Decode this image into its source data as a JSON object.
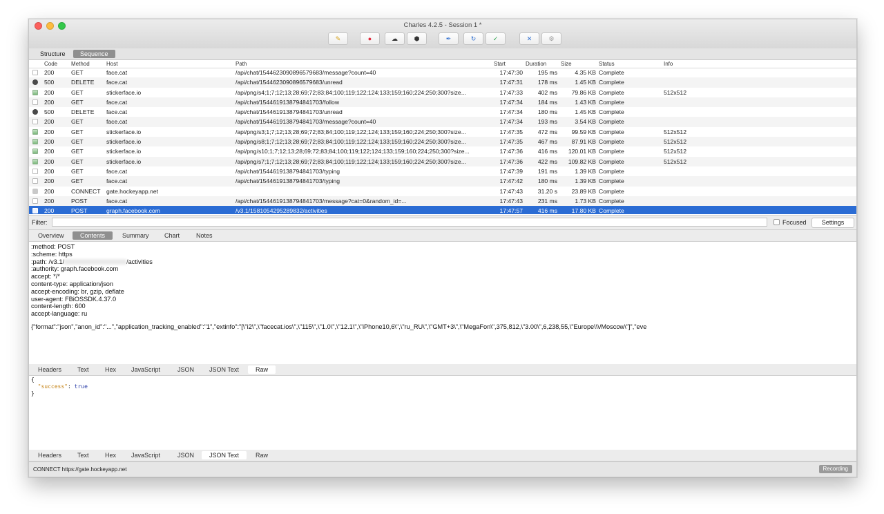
{
  "window": {
    "title": "Charles 4.2.5 - Session 1 *"
  },
  "toolbar": {
    "buttons": [
      {
        "name": "broom-icon",
        "glyph": "✎",
        "color": "#d6a21a"
      },
      {
        "name": "record-icon",
        "glyph": "●",
        "color": "#e0283b"
      },
      {
        "name": "throttle-icon",
        "glyph": "☁",
        "color": "#333333"
      },
      {
        "name": "breakpoint-icon",
        "glyph": "⬢",
        "color": "#333333"
      },
      {
        "name": "pen-icon",
        "glyph": "✒",
        "color": "#2f6fd0"
      },
      {
        "name": "refresh-icon",
        "glyph": "↻",
        "color": "#2f6fd0"
      },
      {
        "name": "check-icon",
        "glyph": "✓",
        "color": "#2aa34b"
      },
      {
        "name": "tools-icon",
        "glyph": "✕",
        "color": "#2f6fd0"
      },
      {
        "name": "settings-icon",
        "glyph": "⚙",
        "color": "#999999"
      }
    ]
  },
  "view_tabs": [
    "Structure",
    "Sequence"
  ],
  "columns": {
    "code": "Code",
    "method": "Method",
    "host": "Host",
    "path": "Path",
    "start": "Start",
    "duration": "Duration",
    "size": "Size",
    "status": "Status",
    "info": "Info"
  },
  "rows": [
    {
      "icon": "doc",
      "code": "200",
      "method": "GET",
      "host": "face.cat",
      "path": "/api/chat/1544623090896579683/message?count=40",
      "start": "17:47:30",
      "duration": "195 ms",
      "size": "4.35 KB",
      "status": "Complete",
      "info": ""
    },
    {
      "icon": "err",
      "code": "500",
      "method": "DELETE",
      "host": "face.cat",
      "path": "/api/chat/1544623090896579683/unread",
      "start": "17:47:31",
      "duration": "178 ms",
      "size": "1.45 KB",
      "status": "Complete",
      "info": ""
    },
    {
      "icon": "img",
      "code": "200",
      "method": "GET",
      "host": "stickerface.io",
      "path": "/api/png/s4;1;7;12;13;28;69;72;83;84;100;119;122;124;133;159;160;224;250;300?size...",
      "start": "17:47:33",
      "duration": "402 ms",
      "size": "79.86 KB",
      "status": "Complete",
      "info": "512x512"
    },
    {
      "icon": "doc",
      "code": "200",
      "method": "GET",
      "host": "face.cat",
      "path": "/api/chat/1544619138794841703/follow",
      "start": "17:47:34",
      "duration": "184 ms",
      "size": "1.43 KB",
      "status": "Complete",
      "info": ""
    },
    {
      "icon": "err",
      "code": "500",
      "method": "DELETE",
      "host": "face.cat",
      "path": "/api/chat/1544619138794841703/unread",
      "start": "17:47:34",
      "duration": "180 ms",
      "size": "1.45 KB",
      "status": "Complete",
      "info": ""
    },
    {
      "icon": "doc",
      "code": "200",
      "method": "GET",
      "host": "face.cat",
      "path": "/api/chat/1544619138794841703/message?count=40",
      "start": "17:47:34",
      "duration": "193 ms",
      "size": "3.54 KB",
      "status": "Complete",
      "info": ""
    },
    {
      "icon": "img",
      "code": "200",
      "method": "GET",
      "host": "stickerface.io",
      "path": "/api/png/s3;1;7;12;13;28;69;72;83;84;100;119;122;124;133;159;160;224;250;300?size...",
      "start": "17:47:35",
      "duration": "472 ms",
      "size": "99.59 KB",
      "status": "Complete",
      "info": "512x512"
    },
    {
      "icon": "img",
      "code": "200",
      "method": "GET",
      "host": "stickerface.io",
      "path": "/api/png/s8;1;7;12;13;28;69;72;83;84;100;119;122;124;133;159;160;224;250;300?size...",
      "start": "17:47:35",
      "duration": "467 ms",
      "size": "87.91 KB",
      "status": "Complete",
      "info": "512x512"
    },
    {
      "icon": "img",
      "code": "200",
      "method": "GET",
      "host": "stickerface.io",
      "path": "/api/png/s10;1;7;12;13;28;69;72;83;84;100;119;122;124;133;159;160;224;250;300?size...",
      "start": "17:47:36",
      "duration": "416 ms",
      "size": "120.01 KB",
      "status": "Complete",
      "info": "512x512"
    },
    {
      "icon": "img",
      "code": "200",
      "method": "GET",
      "host": "stickerface.io",
      "path": "/api/png/s7;1;7;12;13;28;69;72;83;84;100;119;122;124;133;159;160;224;250;300?size...",
      "start": "17:47:36",
      "duration": "422 ms",
      "size": "109.82 KB",
      "status": "Complete",
      "info": "512x512"
    },
    {
      "icon": "doc",
      "code": "200",
      "method": "GET",
      "host": "face.cat",
      "path": "/api/chat/1544619138794841703/typing",
      "start": "17:47:39",
      "duration": "191 ms",
      "size": "1.39 KB",
      "status": "Complete",
      "info": ""
    },
    {
      "icon": "doc",
      "code": "200",
      "method": "GET",
      "host": "face.cat",
      "path": "/api/chat/1544619138794841703/typing",
      "start": "17:47:42",
      "duration": "180 ms",
      "size": "1.39 KB",
      "status": "Complete",
      "info": ""
    },
    {
      "icon": "lock",
      "code": "200",
      "method": "CONNECT",
      "host": "gate.hockeyapp.net",
      "path": "",
      "start": "17:47:43",
      "duration": "31.20 s",
      "size": "23.89 KB",
      "status": "Complete",
      "info": ""
    },
    {
      "icon": "doc",
      "code": "200",
      "method": "POST",
      "host": "face.cat",
      "path": "/api/chat/1544619138794841703/message?cat=0&random_id=...",
      "start": "17:47:43",
      "duration": "231 ms",
      "size": "1.73 KB",
      "status": "Complete",
      "info": ""
    },
    {
      "icon": "doc",
      "code": "200",
      "method": "POST",
      "host": "graph.facebook.com",
      "path": "/v3.1/1581054295289832/activities",
      "start": "17:47:57",
      "duration": "416 ms",
      "size": "17.80 KB",
      "status": "Complete",
      "info": "",
      "selected": true
    }
  ],
  "filter": {
    "label": "Filter:",
    "value": "",
    "focused_label": "Focused",
    "settings_label": "Settings"
  },
  "detail_tabs": [
    "Overview",
    "Contents",
    "Summary",
    "Chart",
    "Notes"
  ],
  "headers": [
    ":method: POST",
    ":scheme: https",
    ":path: /v3.1/",
    ":authority: graph.facebook.com",
    "accept: */*",
    "content-type: application/json",
    "accept-encoding: br, gzip, deflate",
    "user-agent: FBiOSSDK.4.37.0",
    "content-length: 600",
    "accept-language: ru"
  ],
  "path_suffix": "/activities",
  "request_body": "{\"format\":\"json\",\"anon_id\":\"...\",\"application_tracking_enabled\":\"1\",\"extinfo\":\"[\\\"i2\\\",\\\"facecat.ios\\\",\\\"115\\\",\\\"1.0\\\",\\\"12.1\\\",\\\"iPhone10,6\\\",\\\"ru_RU\\\",\\\"GMT+3\\\",\\\"MegaFon\\\",375,812,\\\"3.00\\\",6,238,55,\\\"Europe\\\\\\/Moscow\\\"]\",\"eve",
  "request_tabs": [
    "Headers",
    "Text",
    "Hex",
    "JavaScript",
    "JSON",
    "JSON Text",
    "Raw"
  ],
  "response_json": {
    "open": "{",
    "key": "\"success\"",
    "colon": ": ",
    "value": "true",
    "close": "}"
  },
  "response_tabs": [
    "Headers",
    "Text",
    "Hex",
    "JavaScript",
    "JSON",
    "JSON Text",
    "Raw"
  ],
  "status": {
    "text": "CONNECT https://gate.hockeyapp.net",
    "badge": "Recording"
  },
  "colors": {
    "selection": "#2b6cd4",
    "accent_tab": "#8f8f8f"
  }
}
